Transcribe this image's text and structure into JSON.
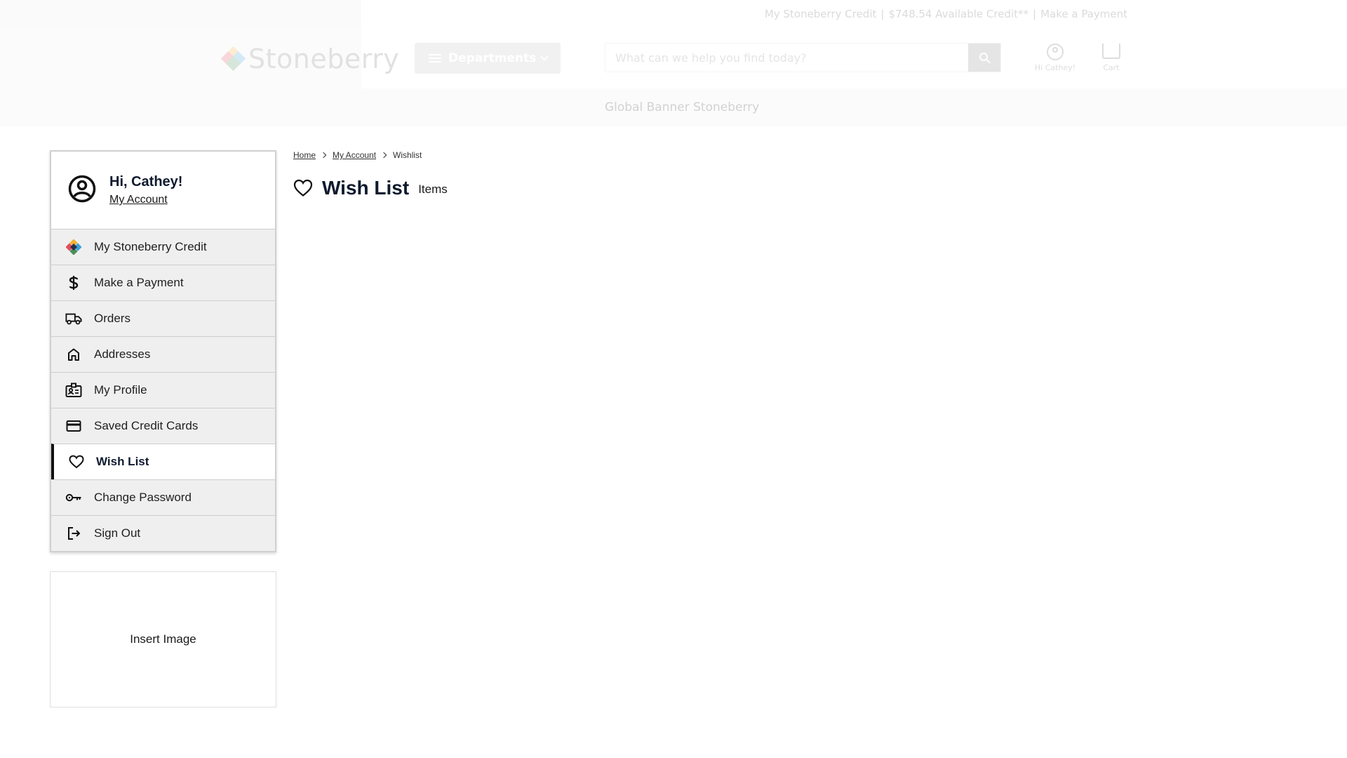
{
  "topbar": {
    "credit_label": "My Stoneberry Credit",
    "available_credit": "$748.54 Available Credit**",
    "payment_link": "Make a Payment"
  },
  "header": {
    "logo_text": "Stoneberry",
    "departments_label": "Departments",
    "search_placeholder": "What can we help you find today?",
    "account_label": "Hi Cathey!",
    "cart_label": "Cart"
  },
  "banner": {
    "text": "Global Banner Stoneberry"
  },
  "sidebar": {
    "greeting": "Hi, Cathey!",
    "account_link": "My Account",
    "items": [
      {
        "label": "My Stoneberry Credit",
        "icon": "stoneberry-logo-icon",
        "active": false
      },
      {
        "label": "Make a Payment",
        "icon": "dollar-icon",
        "active": false
      },
      {
        "label": "Orders",
        "icon": "truck-icon",
        "active": false
      },
      {
        "label": "Addresses",
        "icon": "home-icon",
        "active": false
      },
      {
        "label": "My Profile",
        "icon": "id-card-icon",
        "active": false
      },
      {
        "label": "Saved Credit Cards",
        "icon": "credit-card-icon",
        "active": false
      },
      {
        "label": "Wish List",
        "icon": "heart-icon",
        "active": true
      },
      {
        "label": "Change Password",
        "icon": "key-icon",
        "active": false
      },
      {
        "label": "Sign Out",
        "icon": "sign-out-icon",
        "active": false
      }
    ]
  },
  "promo": {
    "text": "Insert Image"
  },
  "breadcrumb": {
    "home": "Home",
    "account": "My Account",
    "current": "Wishlist"
  },
  "main": {
    "title": "Wish List",
    "count_label": "Items"
  },
  "colors": {
    "brand_dark": "#0f1a2e",
    "active_border": "#111111",
    "menu_bg": "#efefef"
  }
}
